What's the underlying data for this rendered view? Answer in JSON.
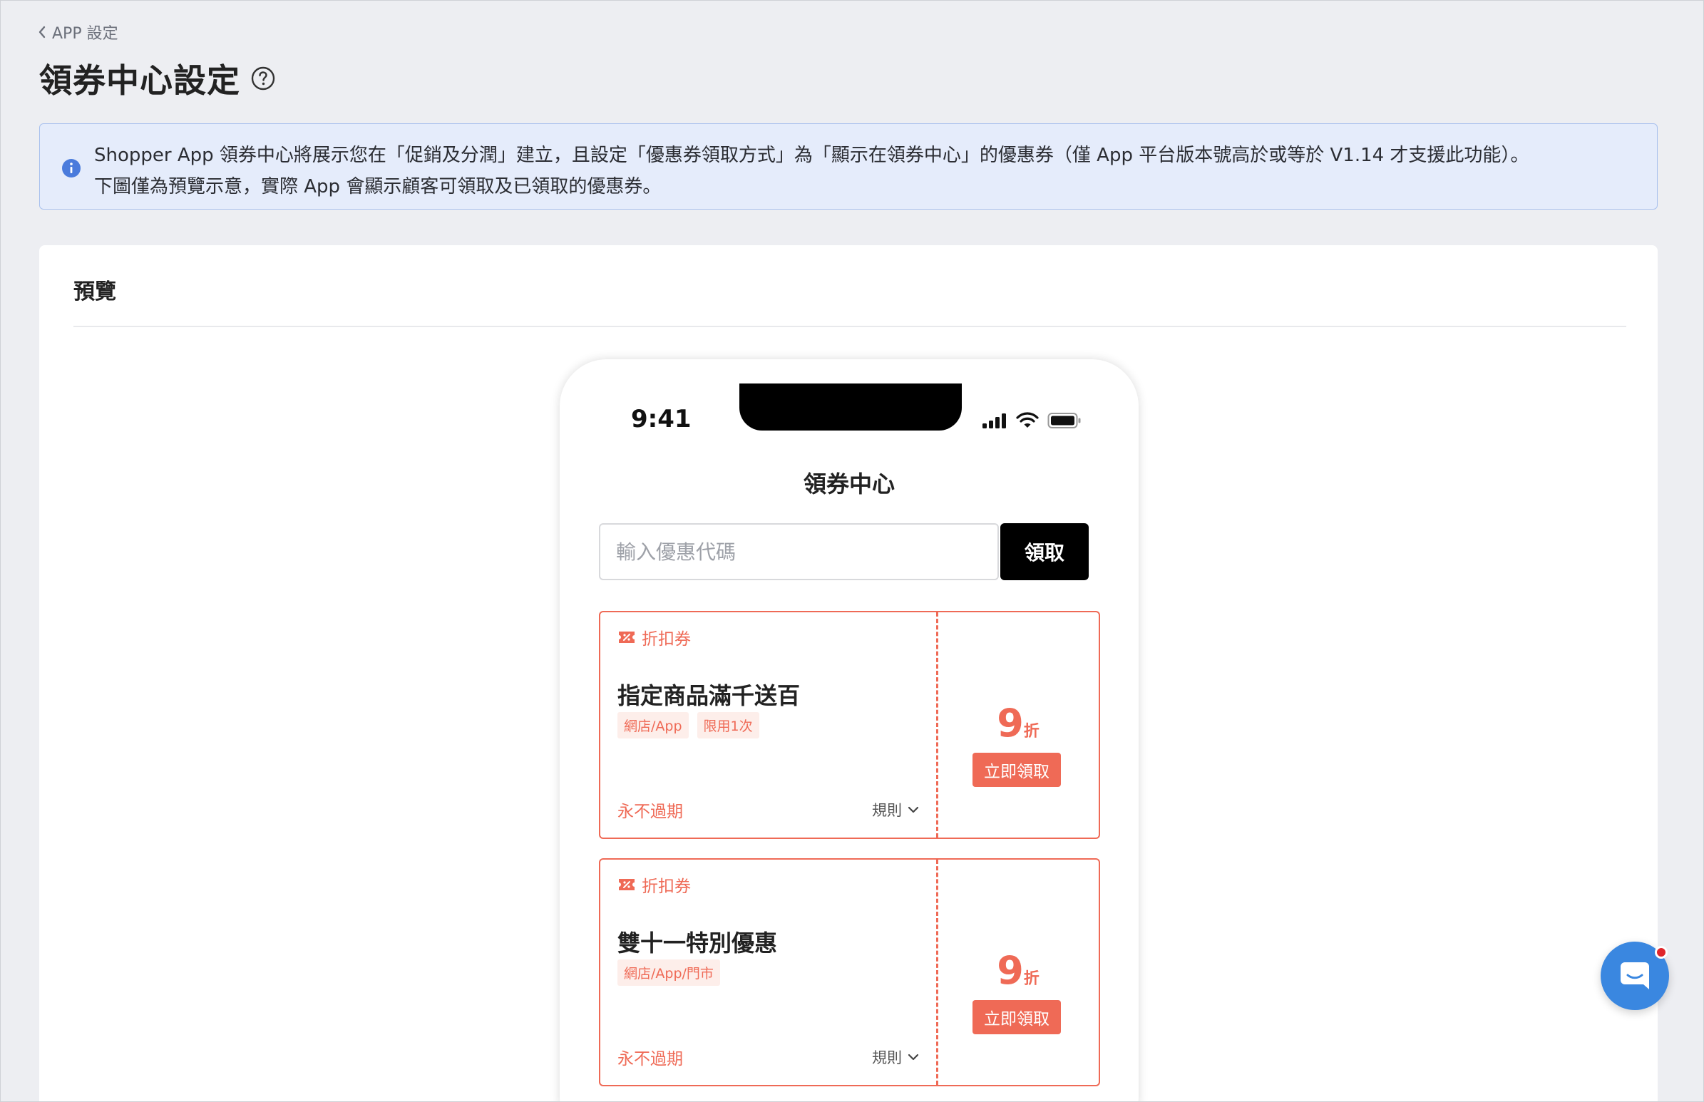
{
  "breadcrumb": {
    "label": "APP 設定"
  },
  "header": {
    "title": "領券中心設定"
  },
  "info_banner": {
    "line1": "Shopper App 領券中心將展示您在「促銷及分潤」建立，且設定「優惠券領取方式」為「顯示在領券中心」的優惠券（僅 App 平台版本號高於或等於 V1.14 才支援此功能）。",
    "line2": "下圖僅為預覽示意，實際 App 會顯示顧客可領取及已領取的優惠券。"
  },
  "preview": {
    "title": "預覽"
  },
  "phone": {
    "time": "9:41",
    "app_title": "領券中心",
    "code_placeholder": "輸入優惠代碼",
    "redeem_label": "領取",
    "coupons": [
      {
        "type": "折扣券",
        "title": "指定商品滿千送百",
        "tags": [
          "網店/App",
          "限用1次"
        ],
        "expiry": "永不過期",
        "rules_label": "規則",
        "discount_value": "9",
        "discount_unit": "折",
        "claim_label": "立即領取"
      },
      {
        "type": "折扣券",
        "title": "雙十一特別優惠",
        "tags": [
          "網店/App/門市"
        ],
        "expiry": "永不過期",
        "rules_label": "規則",
        "discount_value": "9",
        "discount_unit": "折",
        "claim_label": "立即領取"
      }
    ]
  },
  "colors": {
    "accent": "#ef6a56",
    "banner_bg": "#e5ecfb",
    "chat": "#3a87e0"
  },
  "icons": {
    "breadcrumb": "chevron-left-icon",
    "help": "question-circle-icon",
    "info": "info-circle-icon",
    "coupon_type": "discount-ticket-icon",
    "rules": "chevron-down-icon",
    "chat": "chat-icon"
  }
}
